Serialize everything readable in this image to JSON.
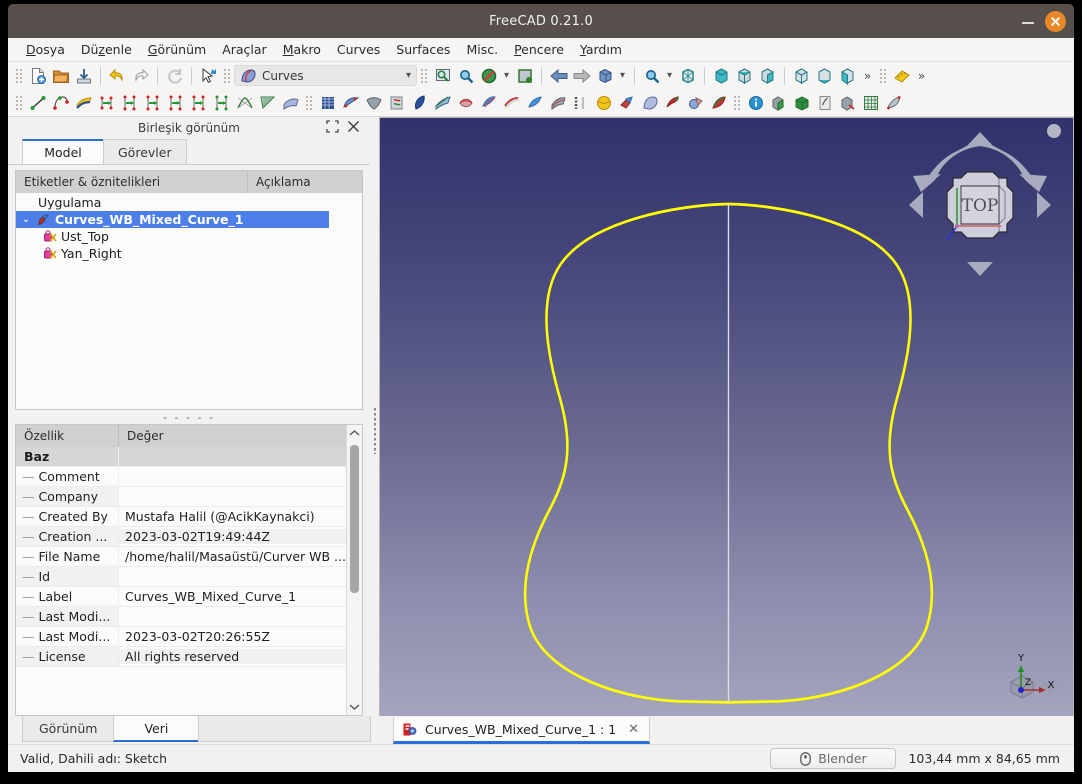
{
  "window": {
    "title": "FreeCAD 0.21.0",
    "minimize_label": "–",
    "close_label": "✕"
  },
  "menubar": {
    "items": [
      {
        "label": "Dosya",
        "accel": "D"
      },
      {
        "label": "Düzenle",
        "accel": "z"
      },
      {
        "label": "Görünüm",
        "accel": "G"
      },
      {
        "label": "Araçlar",
        "accel": ""
      },
      {
        "label": "Makro",
        "accel": "M"
      },
      {
        "label": "Curves",
        "accel": ""
      },
      {
        "label": "Surfaces",
        "accel": ""
      },
      {
        "label": "Misc.",
        "accel": ""
      },
      {
        "label": "Pencere",
        "accel": "P"
      },
      {
        "label": "Yardım",
        "accel": "Y"
      }
    ]
  },
  "toolbar": {
    "workbench_selector": {
      "value": "Curves",
      "icon": "curves-workbench-icon",
      "arrow": "▾"
    },
    "row1_icons": [
      "new-document-icon",
      "open-document-icon",
      "save-document-icon",
      "undo-icon",
      "redo-icon",
      "refresh-icon",
      "std-select-icon"
    ],
    "row1_view_icons": [
      "fit-all-icon",
      "fit-selection-icon",
      "draw-style-icon",
      "std-view-icon",
      "previous-view-icon",
      "next-view-icon",
      "axonometric-icon",
      "zoom-icon",
      "box-zoom-icon",
      "view-front-icon",
      "view-top-icon",
      "view-right-icon",
      "view-rear-icon",
      "view-bottom-icon",
      "view-left-icon",
      "measure-icon"
    ],
    "row2_icons": [
      "line-icon",
      "bspline-icon",
      "curve-extend-icon",
      "join-curve-icon",
      "split-curve-icon",
      "discretize-icon",
      "approximate-icon",
      "interpolate-icon",
      "parametric-blend-icon",
      "blend-curve-icon",
      "comb-plot-icon",
      "zebra-icon",
      "gordon-surface-icon",
      "sweep-surface-icon",
      "flatten-face-icon",
      "pipeshell-icon",
      "segment-surface-icon",
      "ruled-surface-icon",
      "profile-support-icon",
      "isocurve-icon",
      "sketch-on-surface-icon",
      "trim-face-icon",
      "solid-icon",
      "sphere-icon",
      "boolean-icon",
      "surface-filling-icon",
      "curve-on-mesh-icon",
      "mesh-boolean-icon",
      "multi-transform-icon",
      "info-icon",
      "part-box-icon",
      "green-box-icon",
      "sketch-icon",
      "shape-builder-icon",
      "grid-icon",
      "shape-info-icon"
    ],
    "overflow_label": "»"
  },
  "left_dock": {
    "title": "Birleşik görünüm",
    "float_icon": "restore-icon",
    "close_icon": "close-icon",
    "top_tabs": [
      {
        "label": "Model",
        "active": true
      },
      {
        "label": "Görevler",
        "active": false
      }
    ],
    "tree": {
      "columns": [
        "Etiketler & öznitelikleri",
        "Açıklama"
      ],
      "rows": [
        {
          "label": "Uygulama",
          "level": 0,
          "selected": false,
          "icon": ""
        },
        {
          "label": "Curves_WB_Mixed_Curve_1",
          "level": 1,
          "selected": true,
          "icon": "document-icon",
          "twisty": "⌄"
        },
        {
          "label": "Ust_Top",
          "level": 2,
          "selected": false,
          "icon": "sketch-icon"
        },
        {
          "label": "Yan_Right",
          "level": 2,
          "selected": false,
          "icon": "sketch-icon"
        }
      ]
    },
    "splitter_glyph": "- - - - -",
    "properties": {
      "columns": [
        "Özellik",
        "Değer"
      ],
      "rows": [
        {
          "name": "Baz",
          "value": "",
          "group": true
        },
        {
          "name": "Comment",
          "value": ""
        },
        {
          "name": "Company",
          "value": ""
        },
        {
          "name": "Created By",
          "value": "Mustafa Halil (@AcikKaynakci)"
        },
        {
          "name": "Creation ...",
          "value": "2023-03-02T19:49:44Z"
        },
        {
          "name": "File Name",
          "value": "/home/halil/Masaüstü/Curver WB ..."
        },
        {
          "name": "Id",
          "value": ""
        },
        {
          "name": "Label",
          "value": "Curves_WB_Mixed_Curve_1"
        },
        {
          "name": "Last Modi...",
          "value": ""
        },
        {
          "name": "Last Modi...",
          "value": "2023-03-02T20:26:55Z"
        },
        {
          "name": "License",
          "value": "All rights reserved"
        }
      ],
      "scroll_up": "⌃",
      "scroll_down": "⌄"
    },
    "bottom_tabs": [
      {
        "label": "Görünüm",
        "active": false
      },
      {
        "label": "Veri",
        "active": true
      }
    ]
  },
  "view": {
    "navcube_label": "TOP",
    "axis_labels": {
      "x": "X",
      "y": "Y",
      "z": "Z"
    },
    "axis_colors": {
      "x": "#b03030",
      "y": "#2f8f2f",
      "z": "#2a2ad0"
    },
    "curve_color": "#ffff00",
    "center_line_color": "#d8d8e8",
    "background_top": "#31316b",
    "background_bottom": "#a4a4be",
    "tab": {
      "label": "Curves_WB_Mixed_Curve_1 : 1",
      "icon": "freecad-document-icon",
      "close": "✕"
    }
  },
  "statusbar": {
    "message": "Valid, Dahili adı: Sketch",
    "nav_style_button": {
      "label": "Blender",
      "icon": "mouse-icon"
    },
    "dimensions": "103,44 mm x 84,65 mm"
  }
}
